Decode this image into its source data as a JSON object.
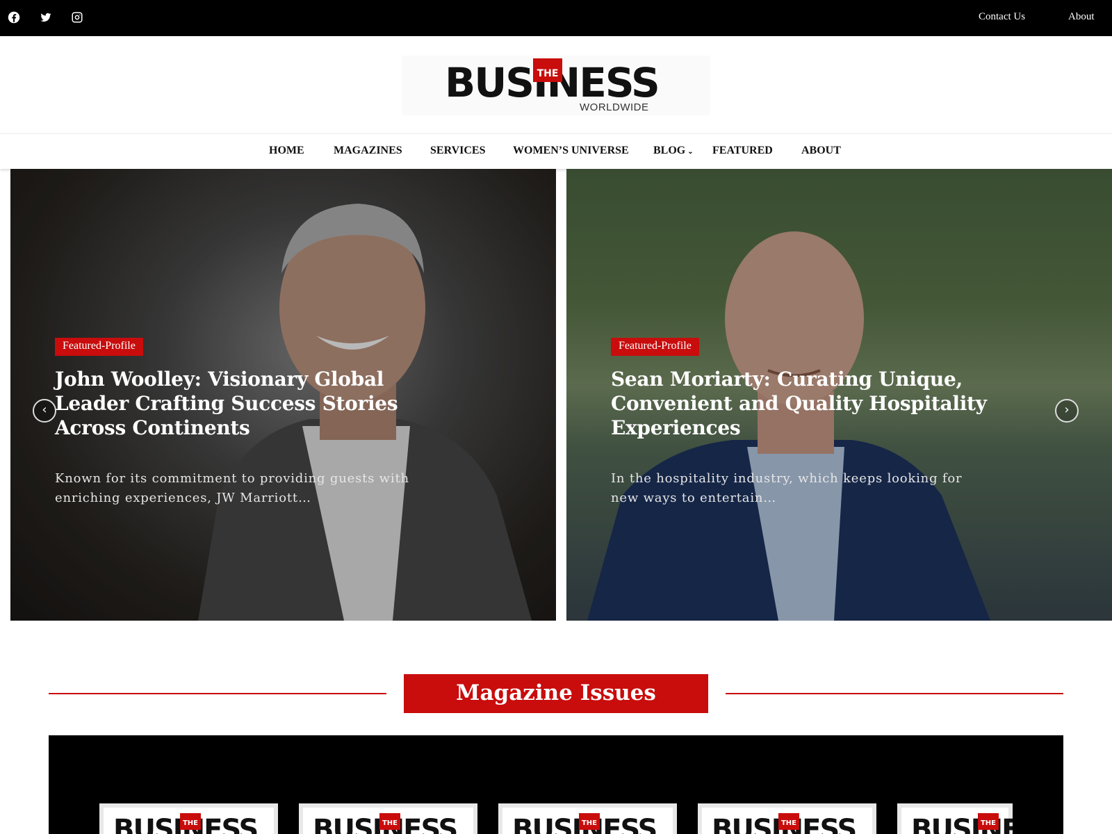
{
  "topbar": {
    "social": [
      "facebook-icon",
      "twitter-icon",
      "instagram-icon"
    ],
    "links": [
      "Contact Us",
      "About"
    ]
  },
  "logo": {
    "the": "THE",
    "main": "BUSINESS",
    "sub": "WORLDWIDE"
  },
  "nav": {
    "items": [
      "HOME",
      "MAGAZINES",
      "SERVICES",
      "WOMEN’S UNIVERSE",
      "BLOG",
      "FEATURED",
      "ABOUT"
    ],
    "chevron": "⌄"
  },
  "hero": {
    "prev_arrow": "‹",
    "next_arrow": "›",
    "slides": [
      {
        "badge": "Featured-Profile",
        "title": "John Woolley: Visionary Global Leader Crafting Success Stories Across Continents",
        "excerpt": "Known for its commitment to providing guests with enriching experiences, JW Marriott…"
      },
      {
        "badge": "Featured-Profile",
        "title": "Sean Moriarty: Curating Unique, Convenient and Quality Hospitality Experiences",
        "excerpt": "In the hospitality industry, which keeps looking for new ways to entertain…"
      }
    ]
  },
  "magazines": {
    "heading": "Magazine Issues",
    "cover_word": "BUSINESS",
    "cover_the": "THE"
  },
  "colors": {
    "brand_red": "#c90c0c",
    "topbar_bg": "#000000"
  }
}
